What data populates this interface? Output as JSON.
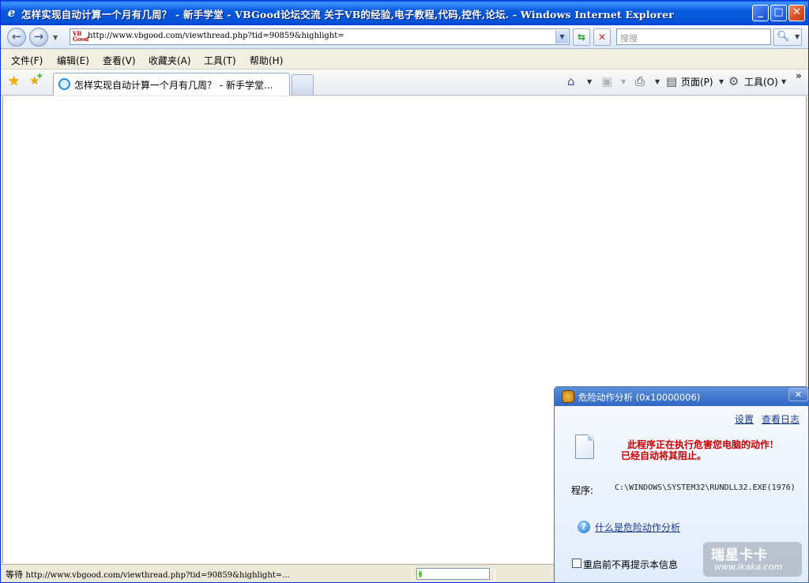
{
  "window": {
    "title": "怎样实现自动计算一个月有几周？ - 新手学堂 - VBGood论坛交流 关于VB的经验,电子教程,代码,控件,论坛. - Windows Internet Explorer",
    "minimize_icon": "minimize-icon",
    "maximize_icon": "maximize-icon",
    "close_icon": "close-icon"
  },
  "address": {
    "url": "http://www.vbgood.com/viewthread.php?tid=90859&highlight=",
    "favicon_text": "VB Good",
    "search_placeholder": "搜搜"
  },
  "menu": {
    "items": [
      {
        "label": "文件(F)"
      },
      {
        "label": "编辑(E)"
      },
      {
        "label": "查看(V)"
      },
      {
        "label": "收藏夹(A)"
      },
      {
        "label": "工具(T)"
      },
      {
        "label": "帮助(H)"
      }
    ]
  },
  "tabs": {
    "active_label": "怎样实现自动计算一个月有几周？ - 新手学堂..."
  },
  "commandbar": {
    "page_label": "页面(P)",
    "tools_label": "工具(O)"
  },
  "status": {
    "state": "等待",
    "url": "http://www.vbgood.com/viewthread.php?tid=90859&highlight=...",
    "progress": 0.05
  },
  "popup": {
    "title": "危险动作分析 (0x10000006)",
    "settings_link": "设置",
    "log_link": "查看日志",
    "warning_line1": "此程序正在执行危害您电脑的动作!",
    "warning_line2": "已经自动将其阻止。",
    "program_label": "程序:",
    "program_path": "C:\\WINDOWS\\SYSTEM32\\RUNDLL32.EXE(1976)",
    "help_link": "什么是危险动作分析",
    "checkbox_label": "重启前不再提示本信息",
    "checkbox_checked": false,
    "watermark_top": "瑞星卡卡",
    "watermark_bottom": "www.ikaka.com"
  },
  "colors": {
    "titlebar": "#0a5ade",
    "warning_text": "#cc0000",
    "link": "#1b3a8a"
  }
}
